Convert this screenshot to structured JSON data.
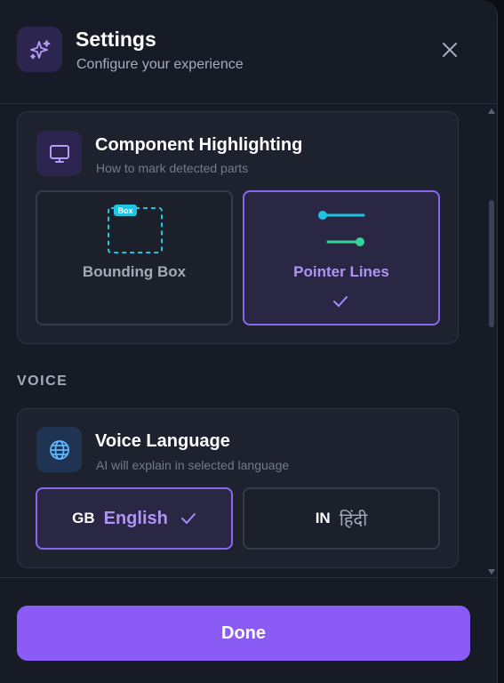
{
  "header": {
    "title": "Settings",
    "subtitle": "Configure your experience",
    "app_icon": "sparkles-icon",
    "close_icon": "close-icon"
  },
  "highlighting": {
    "title": "Component Highlighting",
    "subtitle": "How to mark detected parts",
    "icon": "monitor-icon",
    "options": [
      {
        "label": "Bounding Box",
        "preview_tag": "Box",
        "selected": false
      },
      {
        "label": "Pointer Lines",
        "selected": true
      }
    ]
  },
  "voice_section": {
    "label": "VOICE"
  },
  "voice": {
    "title": "Voice Language",
    "subtitle": "AI will explain in selected language",
    "icon": "globe-icon",
    "options": [
      {
        "code": "GB",
        "name": "English",
        "selected": true
      },
      {
        "code": "IN",
        "name": "हिंदी",
        "selected": false
      }
    ]
  },
  "footer": {
    "done_label": "Done"
  },
  "colors": {
    "accent": "#8a5cf5",
    "accent_text": "#b094f5",
    "cyan": "#22c3e0",
    "green": "#34d399",
    "background": "#161b26"
  }
}
